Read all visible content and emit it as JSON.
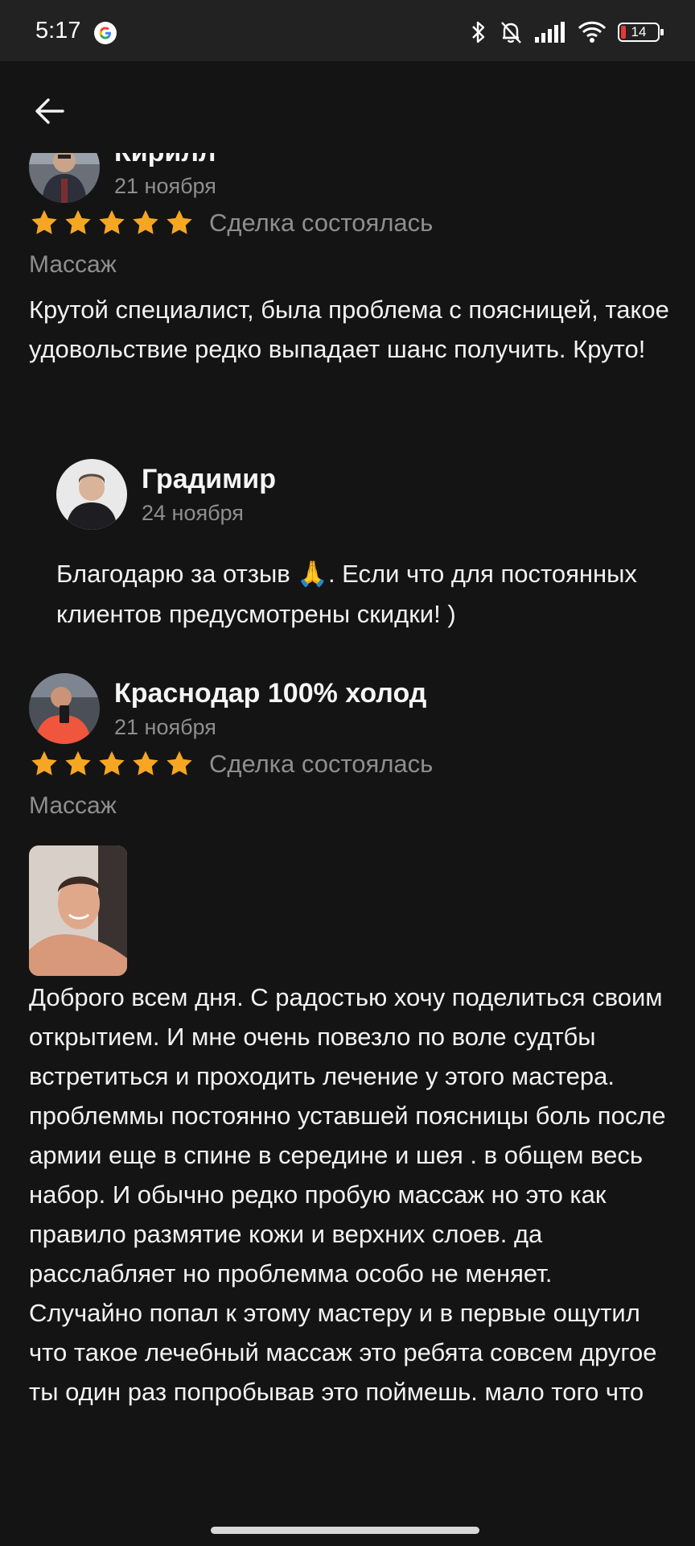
{
  "status_bar": {
    "time": "5:17",
    "battery": "14",
    "icons": [
      "google-icon",
      "bluetooth-icon",
      "bell-off-icon",
      "signal-icon",
      "wifi-icon",
      "battery-icon"
    ]
  },
  "header": {
    "back_icon": "arrow-left-icon"
  },
  "star_color": "#F5A623",
  "reviews": [
    {
      "author": "Кирилл",
      "date": "21 ноября",
      "rating": 5,
      "deal_status": "Сделка состоялась",
      "category": "Массаж",
      "text": "Крутой специалист, была проблема с поясницей, такое удовольствие редко выпадает шанс получить. Круто!",
      "reply": {
        "author": "Градимир",
        "date": "24 ноября",
        "text": "Благодарю за отзыв 🙏. Если что для постоянных клиентов предусмотрены скидки! )"
      }
    },
    {
      "author": "Краснодар 100% холод",
      "date": "21 ноября",
      "rating": 5,
      "deal_status": "Сделка состоялась",
      "category": "Массаж",
      "text": "Доброго всем дня. С радостью хочу поделиться своим открытием. И мне очень повезло по воле судтбы встретиться и проходить лечение у этого мастера.\nпроблеммы постоянно уставшей поясницы боль после армии еще в спине в середине и шея . в общем весь набор. И обычно редко пробую массаж но это как правило размятие кожи и верхних слоев. да расслабляет но проблемма особо не меняет. Случайно попал к этому мастеру и в первые ощутил что такое лечебный массаж это ребята совсем другое ты один раз попробывав это поймешь. мало того что"
    }
  ]
}
